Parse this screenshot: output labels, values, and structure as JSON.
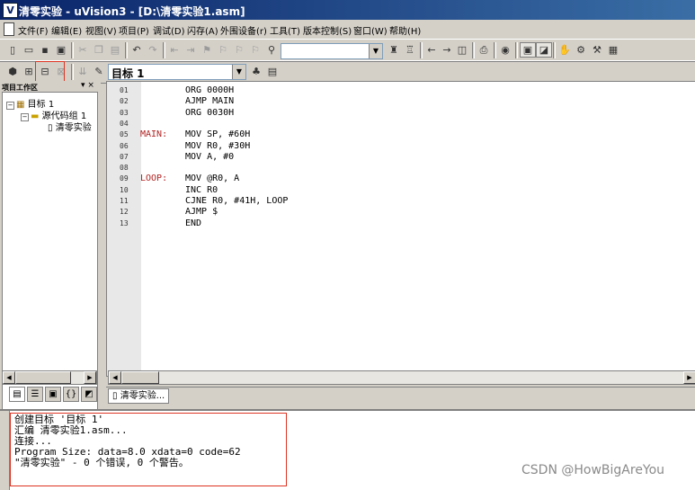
{
  "window": {
    "title": "清零实验 - uVision3 - [D:\\清零实验1.asm]",
    "app_icon": "V"
  },
  "menu": [
    {
      "label": "文件(F)"
    },
    {
      "label": "编辑(E)"
    },
    {
      "label": "视图(V)"
    },
    {
      "label": "项目(P)"
    },
    {
      "label": "调试(D)"
    },
    {
      "label": "闪存(A)"
    },
    {
      "label": "外围设备(r)"
    },
    {
      "label": "工具(T)"
    },
    {
      "label": "版本控制(S)"
    },
    {
      "label": "窗口(W)"
    },
    {
      "label": "帮助(H)"
    }
  ],
  "toolbar": {
    "target_select": "目标 1",
    "find_value": ""
  },
  "project": {
    "panel_title": "项目工作区",
    "tree": [
      {
        "label": "目标 1"
      },
      {
        "label": "源代码组 1"
      },
      {
        "label": "清零实验"
      }
    ]
  },
  "editor": {
    "lines": [
      {
        "num": "01",
        "label": "",
        "code": "ORG 0000H"
      },
      {
        "num": "02",
        "label": "",
        "code": "AJMP MAIN"
      },
      {
        "num": "03",
        "label": "",
        "code": "ORG 0030H"
      },
      {
        "num": "04",
        "label": "",
        "code": ""
      },
      {
        "num": "05",
        "label": "MAIN:",
        "code": "MOV SP, #60H"
      },
      {
        "num": "06",
        "label": "",
        "code": "MOV R0, #30H"
      },
      {
        "num": "07",
        "label": "",
        "code": "MOV A, #0"
      },
      {
        "num": "08",
        "label": "",
        "code": ""
      },
      {
        "num": "09",
        "label": "LOOP:",
        "code": "MOV @R0, A"
      },
      {
        "num": "10",
        "label": "",
        "code": "INC R0"
      },
      {
        "num": "11",
        "label": "",
        "code": "CJNE R0, #41H, LOOP"
      },
      {
        "num": "12",
        "label": "",
        "code": "AJMP $"
      },
      {
        "num": "13",
        "label": "",
        "code": "END"
      }
    ],
    "tab_label": "清零实验..."
  },
  "output": {
    "lines": [
      "创建目标 '目标 1'",
      "汇编 清零实验1.asm...",
      "连接...",
      "Program Size: data=8.0 xdata=0 code=62",
      "\"清零实验\" - 0 个错误, 0 个警告。"
    ]
  },
  "watermark": "CSDN @HowBigAreYou",
  "colors": {
    "title_bar": "#0a246a",
    "label_text": "#b22222",
    "highlight_box": "#dd3322"
  }
}
